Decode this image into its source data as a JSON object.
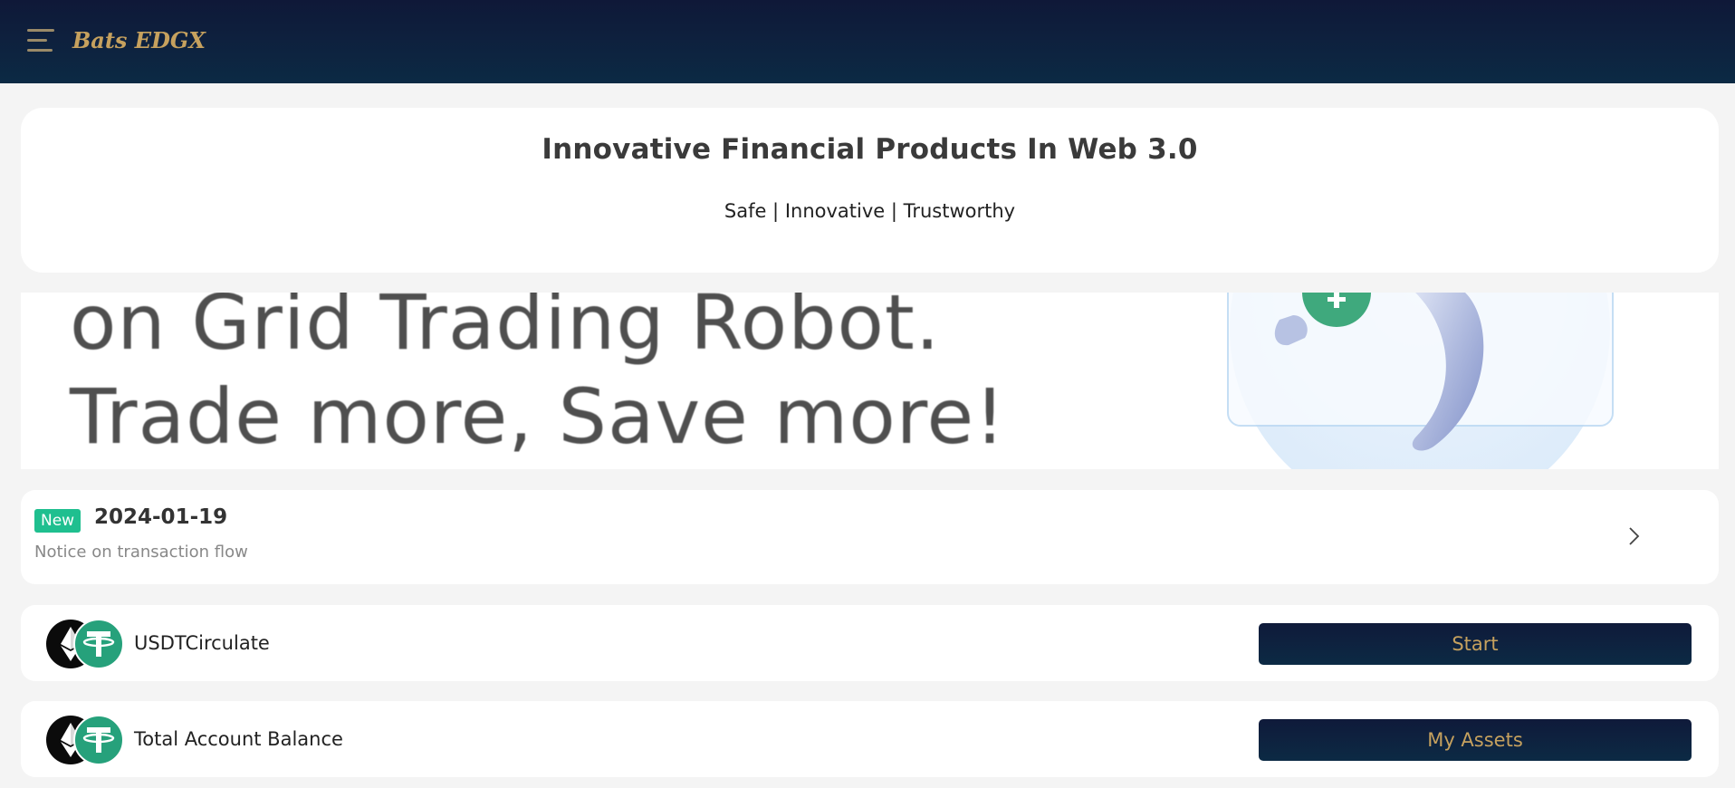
{
  "header": {
    "brand": "Bats EDGX",
    "menu_icon": "hamburger-menu-icon"
  },
  "hero": {
    "title": "Innovative Financial Products In Web 3.0",
    "subtitle": "Safe | Innovative | Trustworthy"
  },
  "banner": {
    "line1": "on Grid Trading Robot.",
    "line2": "Trade more, Save more!"
  },
  "notice": {
    "badge": "New",
    "date": "2024-01-19",
    "text": "Notice on transaction flow",
    "icon": "chevron-right-icon"
  },
  "rows": [
    {
      "label": "USDTCirculate",
      "button": "Start",
      "icons": [
        "ethereum-icon",
        "tether-icon"
      ]
    },
    {
      "label": "Total Account Balance",
      "button": "My Assets",
      "icons": [
        "ethereum-icon",
        "tether-icon"
      ]
    }
  ],
  "colors": {
    "header_bg": "#0f1838",
    "brand_gold": "#c6a15e",
    "badge_green": "#1fbf8f",
    "tether_green": "#26a17b"
  }
}
